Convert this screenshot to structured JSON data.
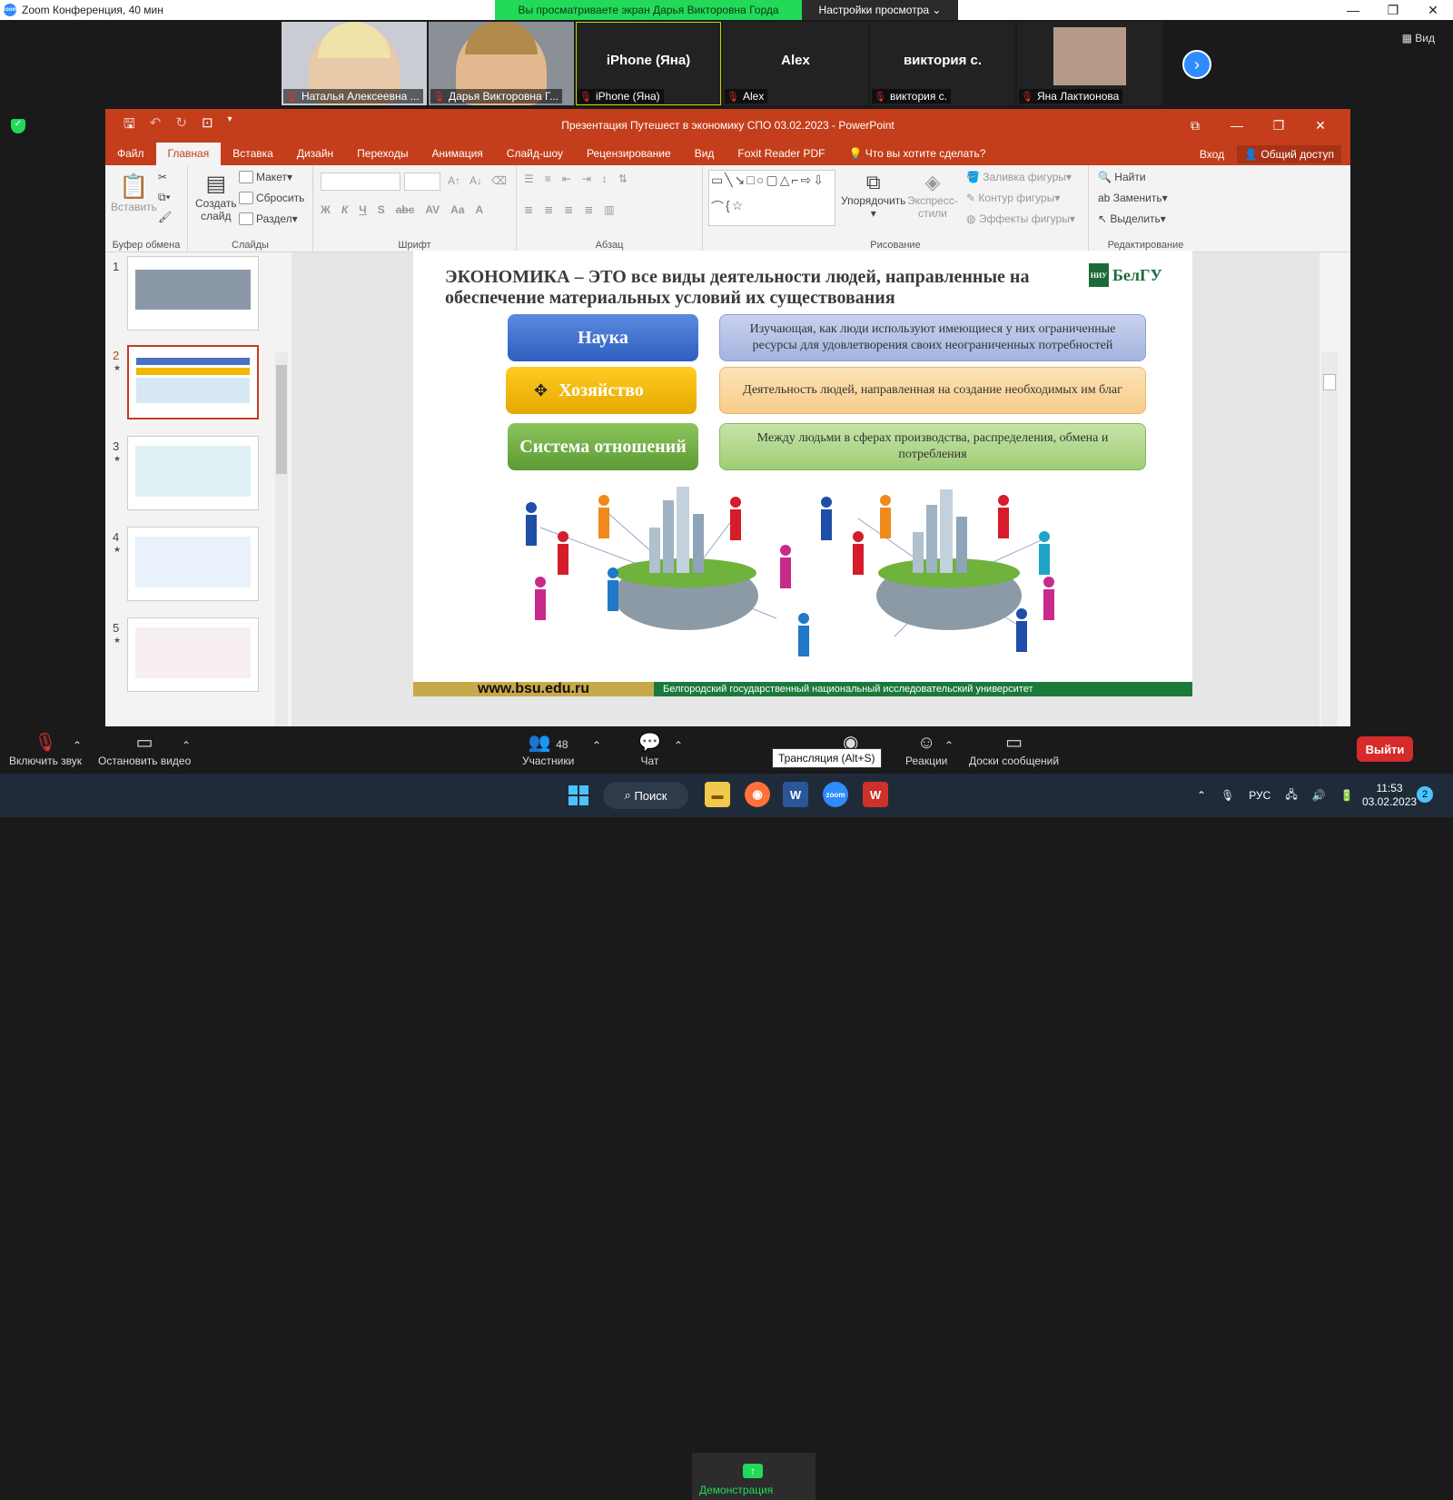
{
  "window": {
    "title": "Zoom Конференция, 40 мин",
    "viewing_banner": "Вы просматриваете экран Дарья Викторовна Горда",
    "view_settings": "Настройки просмотра"
  },
  "gallery": [
    {
      "name": "Наталья Алексеевна ...",
      "video": true
    },
    {
      "name": "Дарья Викторовна Г...",
      "video": true
    },
    {
      "name": "iPhone (Яна)",
      "center": "iPhone (Яна)"
    },
    {
      "name": "Alex",
      "center": "Alex"
    },
    {
      "name": "виктория с.",
      "center": "виктория с."
    },
    {
      "name": "Яна Лактионова",
      "video": true
    }
  ],
  "view_btn": "Вид",
  "ppt": {
    "title": "Презентация Путешест в экономику СПО 03.02.2023 - PowerPoint",
    "tabs": [
      "Файл",
      "Главная",
      "Вставка",
      "Дизайн",
      "Переходы",
      "Анимация",
      "Слайд-шоу",
      "Рецензирование",
      "Вид",
      "Foxit Reader PDF"
    ],
    "tell_me": "Что вы хотите сделать?",
    "signin": "Вход",
    "share": "Общий доступ",
    "groups": {
      "clipboard": "Буфер обмена",
      "slides": "Слайды",
      "font": "Шрифт",
      "paragraph": "Абзац",
      "drawing": "Рисование",
      "editing": "Редактирование"
    },
    "clipboard": {
      "paste": "Вставить"
    },
    "slides": {
      "new_slide_1": "Создать",
      "new_slide_2": "слайд",
      "layout": "Макет",
      "reset": "Сбросить",
      "section": "Раздел"
    },
    "drawing": {
      "arrange": "Упорядочить",
      "quick_1": "Экспресс-",
      "quick_2": "стили",
      "fill": "Заливка фигуры",
      "outline": "Контур фигуры",
      "effects": "Эффекты фигуры"
    },
    "editing": {
      "find": "Найти",
      "replace": "Заменить",
      "select": "Выделить"
    },
    "thumbnails": [
      "1",
      "2",
      "3",
      "4",
      "5"
    ]
  },
  "slide": {
    "title": "ЭКОНОМИКА – ЭТО все виды деятельности людей, направленные на обеспечение материальных условий их существования",
    "logo": "БелГУ",
    "rows": [
      {
        "label": "Наука",
        "text": "Изучающая, как люди используют имеющиеся у них ограниченные ресурсы для удовлетворения своих неограниченных потребностей"
      },
      {
        "label": "Хозяйство",
        "text": "Деятельность людей, направленная на создание необходимых им благ"
      },
      {
        "label": "Система отношений",
        "text": "Между людьми в сферах производства, распределения, обмена и потребления"
      }
    ],
    "footer_url": "www.bsu.edu.ru",
    "footer_text": "Белгородский государственный национальный исследовательский университет"
  },
  "zoom_bar": {
    "unmute": "Включить звук",
    "video": "Остановить видео",
    "participants": "Участники",
    "participants_count": "48",
    "chat": "Чат",
    "share": "Демонстрация",
    "tooltip": "Трансляция (Alt+S)",
    "reactions": "Реакции",
    "whiteboards": "Доски сообщений",
    "leave": "Выйти"
  },
  "taskbar": {
    "search": "Поиск",
    "lang": "РУС",
    "time": "11:53",
    "date": "03.02.2023",
    "badge": "2"
  }
}
